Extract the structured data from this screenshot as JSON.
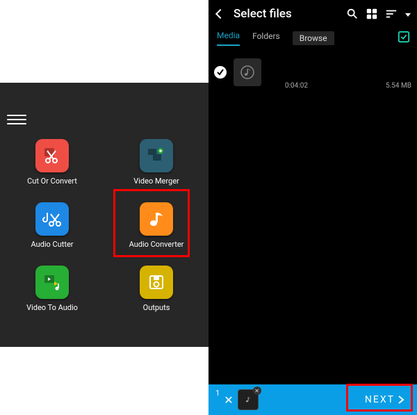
{
  "left": {
    "apps": [
      {
        "label": "Cut Or Convert",
        "bg": "#ef4e45",
        "icon": "scissors"
      },
      {
        "label": "Video Merger",
        "bg": "#2d5f73",
        "icon": "merge"
      },
      {
        "label": "Audio Cutter",
        "bg": "#1e88e5",
        "icon": "scissors"
      },
      {
        "label": "Audio Converter",
        "bg": "#ff8c1a",
        "icon": "note"
      },
      {
        "label": "Video To Audio",
        "bg": "#27ae35",
        "icon": "v2a"
      },
      {
        "label": "Outputs",
        "bg": "#d6b300",
        "icon": "save"
      }
    ]
  },
  "right": {
    "title": "Select files",
    "tabs": {
      "media": "Media",
      "folders": "Folders",
      "browse": "Browse"
    },
    "item": {
      "duration": "0:04:02",
      "size": "5.54 MB"
    },
    "footer": {
      "count": "1",
      "next": "NEXT"
    }
  }
}
